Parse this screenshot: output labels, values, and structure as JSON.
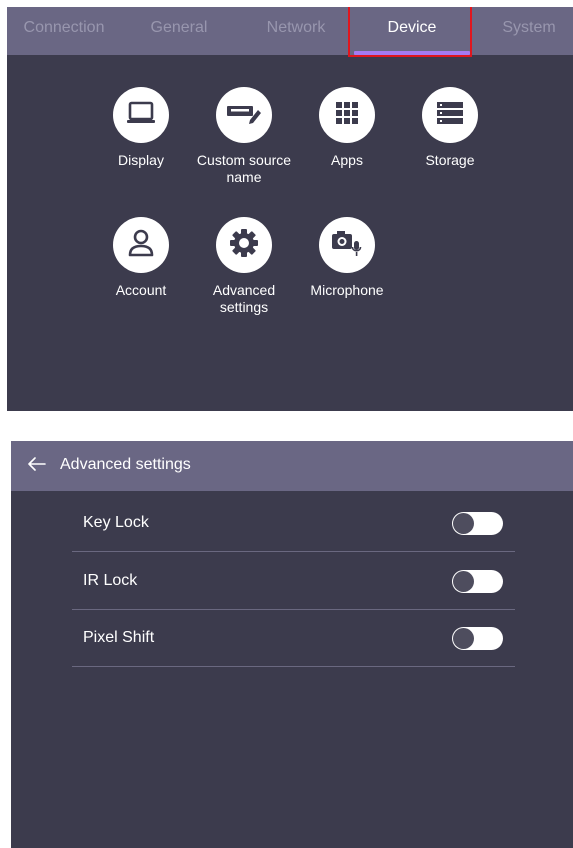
{
  "device_screen": {
    "tabs": [
      {
        "label": "Connection",
        "active": false
      },
      {
        "label": "General",
        "active": false
      },
      {
        "label": "Network",
        "active": false
      },
      {
        "label": "Device",
        "active": true
      },
      {
        "label": "System",
        "active": false
      }
    ],
    "tiles": [
      {
        "label": "Display",
        "icon": "laptop-icon"
      },
      {
        "label": "Custom source name",
        "icon": "rename-tag-icon"
      },
      {
        "label": "Apps",
        "icon": "apps-grid-icon"
      },
      {
        "label": "Storage",
        "icon": "storage-list-icon"
      },
      {
        "label": "Account",
        "icon": "person-icon"
      },
      {
        "label": "Advanced settings",
        "icon": "gear-icon"
      },
      {
        "label": "Microphone",
        "icon": "camera-microphone-icon"
      }
    ]
  },
  "advanced_screen": {
    "back_icon": "back-arrow-icon",
    "title": "Advanced settings",
    "settings": [
      {
        "label": "Key Lock",
        "enabled": false
      },
      {
        "label": "IR Lock",
        "enabled": false
      },
      {
        "label": "Pixel Shift",
        "enabled": false
      }
    ]
  },
  "colors": {
    "background": "#3c3b4d",
    "header": "#6a6784",
    "accent": "#a57bf2",
    "highlight_box": "#e0161e",
    "text": "#ffffff",
    "inactive_tab_text": "#9896ae"
  }
}
